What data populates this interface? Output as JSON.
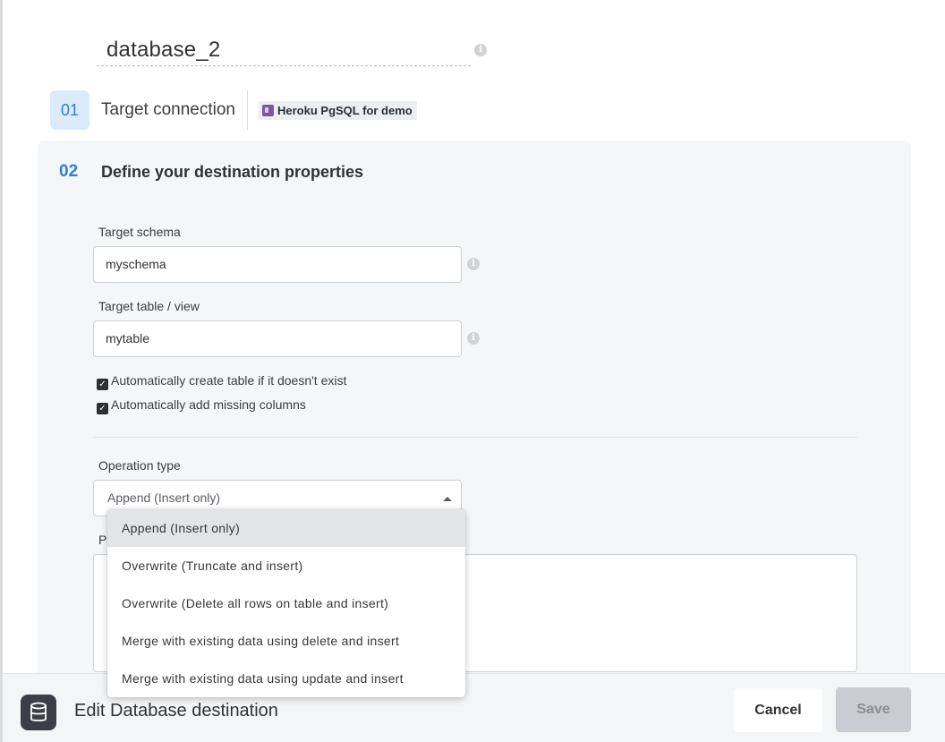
{
  "destination": {
    "name": "database_2"
  },
  "step1": {
    "number": "01",
    "label": "Target connection",
    "connection_name": "Heroku PgSQL for demo",
    "connection_icon": "heroku-icon"
  },
  "step2": {
    "number": "02",
    "title": "Define your destination properties",
    "target_schema": {
      "label": "Target schema",
      "value": "myschema"
    },
    "target_table": {
      "label": "Target table / view",
      "value": "mytable"
    },
    "options": [
      {
        "label": "Automatically create table if it doesn't exist",
        "checked": true
      },
      {
        "label": "Automatically add missing columns",
        "checked": true
      }
    ],
    "operation_type": {
      "label": "Operation type",
      "selected": "Append (Insert only)",
      "options": [
        "Append (Insert only)",
        "Overwrite (Truncate and insert)",
        "Overwrite (Delete all rows on table and insert)",
        "Merge with existing data using delete and insert",
        "Merge with existing data using update and insert"
      ]
    },
    "obscured_label": "P"
  },
  "footer": {
    "title": "Edit Database destination",
    "icon": "database-icon",
    "cancel_label": "Cancel",
    "save_label": "Save"
  },
  "colors": {
    "accent": "#2f7fd6",
    "accent_bg": "#dcebfb",
    "panel_bg": "#f5f6f7",
    "disabled_button": "#c9ccd0"
  }
}
